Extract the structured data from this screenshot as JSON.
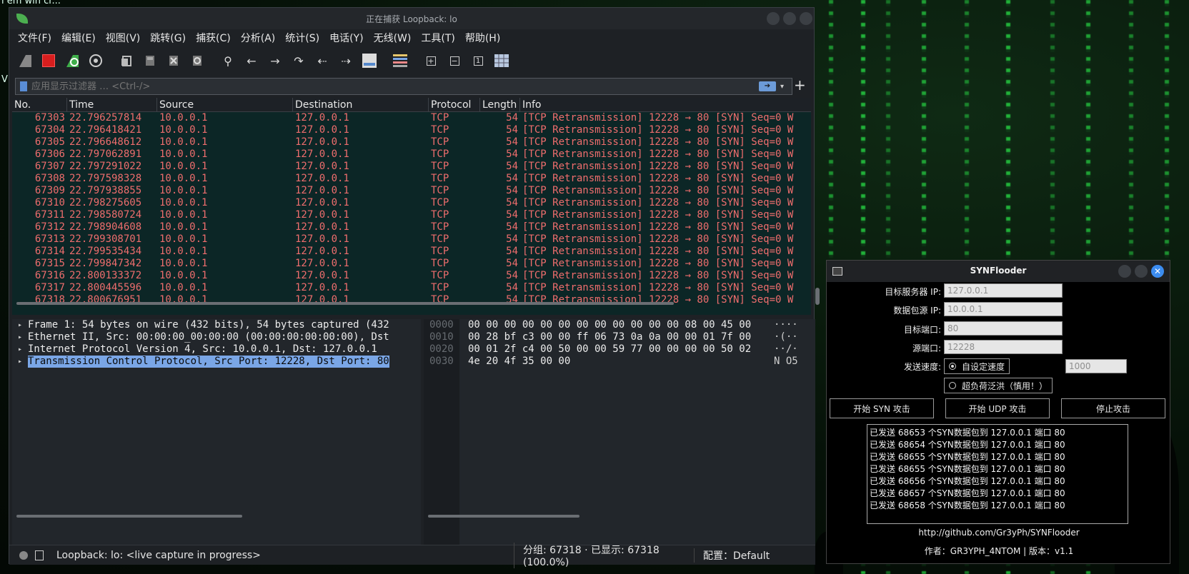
{
  "desktop": {
    "clipped_text": "ı em win cr...",
    "clipped_text_2": "V"
  },
  "wireshark": {
    "title": "正在捕获 Loopback: lo",
    "menu": [
      "文件(F)",
      "编辑(E)",
      "视图(V)",
      "跳转(G)",
      "捕获(C)",
      "分析(A)",
      "统计(S)",
      "电话(Y)",
      "无线(W)",
      "工具(T)",
      "帮助(H)"
    ],
    "filter_placeholder": "应用显示过滤器 … <Ctrl-/>",
    "columns": [
      "No.",
      "Time",
      "Source",
      "Destination",
      "Protocol",
      "Length",
      "Info"
    ],
    "packets": [
      {
        "no": "67303",
        "time": "22.796257814",
        "src": "10.0.0.1",
        "dst": "127.0.0.1",
        "proto": "TCP",
        "len": "54",
        "info": "[TCP Retransmission] 12228 → 80 [SYN] Seq=0 W"
      },
      {
        "no": "67304",
        "time": "22.796418421",
        "src": "10.0.0.1",
        "dst": "127.0.0.1",
        "proto": "TCP",
        "len": "54",
        "info": "[TCP Retransmission] 12228 → 80 [SYN] Seq=0 W"
      },
      {
        "no": "67305",
        "time": "22.796648612",
        "src": "10.0.0.1",
        "dst": "127.0.0.1",
        "proto": "TCP",
        "len": "54",
        "info": "[TCP Retransmission] 12228 → 80 [SYN] Seq=0 W"
      },
      {
        "no": "67306",
        "time": "22.797062891",
        "src": "10.0.0.1",
        "dst": "127.0.0.1",
        "proto": "TCP",
        "len": "54",
        "info": "[TCP Retransmission] 12228 → 80 [SYN] Seq=0 W"
      },
      {
        "no": "67307",
        "time": "22.797291022",
        "src": "10.0.0.1",
        "dst": "127.0.0.1",
        "proto": "TCP",
        "len": "54",
        "info": "[TCP Retransmission] 12228 → 80 [SYN] Seq=0 W"
      },
      {
        "no": "67308",
        "time": "22.797598328",
        "src": "10.0.0.1",
        "dst": "127.0.0.1",
        "proto": "TCP",
        "len": "54",
        "info": "[TCP Retransmission] 12228 → 80 [SYN] Seq=0 W"
      },
      {
        "no": "67309",
        "time": "22.797938855",
        "src": "10.0.0.1",
        "dst": "127.0.0.1",
        "proto": "TCP",
        "len": "54",
        "info": "[TCP Retransmission] 12228 → 80 [SYN] Seq=0 W"
      },
      {
        "no": "67310",
        "time": "22.798275605",
        "src": "10.0.0.1",
        "dst": "127.0.0.1",
        "proto": "TCP",
        "len": "54",
        "info": "[TCP Retransmission] 12228 → 80 [SYN] Seq=0 W"
      },
      {
        "no": "67311",
        "time": "22.798580724",
        "src": "10.0.0.1",
        "dst": "127.0.0.1",
        "proto": "TCP",
        "len": "54",
        "info": "[TCP Retransmission] 12228 → 80 [SYN] Seq=0 W"
      },
      {
        "no": "67312",
        "time": "22.798904608",
        "src": "10.0.0.1",
        "dst": "127.0.0.1",
        "proto": "TCP",
        "len": "54",
        "info": "[TCP Retransmission] 12228 → 80 [SYN] Seq=0 W"
      },
      {
        "no": "67313",
        "time": "22.799308701",
        "src": "10.0.0.1",
        "dst": "127.0.0.1",
        "proto": "TCP",
        "len": "54",
        "info": "[TCP Retransmission] 12228 → 80 [SYN] Seq=0 W"
      },
      {
        "no": "67314",
        "time": "22.799535434",
        "src": "10.0.0.1",
        "dst": "127.0.0.1",
        "proto": "TCP",
        "len": "54",
        "info": "[TCP Retransmission] 12228 → 80 [SYN] Seq=0 W"
      },
      {
        "no": "67315",
        "time": "22.799847342",
        "src": "10.0.0.1",
        "dst": "127.0.0.1",
        "proto": "TCP",
        "len": "54",
        "info": "[TCP Retransmission] 12228 → 80 [SYN] Seq=0 W"
      },
      {
        "no": "67316",
        "time": "22.800133372",
        "src": "10.0.0.1",
        "dst": "127.0.0.1",
        "proto": "TCP",
        "len": "54",
        "info": "[TCP Retransmission] 12228 → 80 [SYN] Seq=0 W"
      },
      {
        "no": "67317",
        "time": "22.800445596",
        "src": "10.0.0.1",
        "dst": "127.0.0.1",
        "proto": "TCP",
        "len": "54",
        "info": "[TCP Retransmission] 12228 → 80 [SYN] Seq=0 W"
      },
      {
        "no": "67318",
        "time": "22.800676951",
        "src": "10.0.0.1",
        "dst": "127.0.0.1",
        "proto": "TCP",
        "len": "54",
        "info": "[TCP Retransmission] 12228 → 80 [SYN] Seq=0 W"
      }
    ],
    "details": [
      "Frame 1: 54 bytes on wire (432 bits), 54 bytes captured (432",
      "Ethernet II, Src: 00:00:00_00:00:00 (00:00:00:00:00:00), Dst",
      "Internet Protocol Version 4, Src: 10.0.0.1, Dst: 127.0.0.1",
      "Transmission Control Protocol, Src Port: 12228, Dst Port: 80"
    ],
    "hex": [
      {
        "off": "0000",
        "hex": "00 00 00 00 00 00 00 00  00 00 00 00 08 00 45 00",
        "ascii": "····"
      },
      {
        "off": "0010",
        "hex": "00 28 bf c3 00 00 ff 06  73 0a 0a 00 00 01 7f 00",
        "ascii": "·(··"
      },
      {
        "off": "0020",
        "hex": "00 01 2f c4 00 50 00 00  59 77 00 00 00 00 50 02",
        "ascii": "··/·"
      },
      {
        "off": "0030",
        "hex": "4e 20 4f 35 00 00",
        "ascii": "N O5"
      }
    ],
    "status": {
      "interface": "Loopback: lo: <live capture in progress>",
      "packets": "分组: 67318 · 已显示: 67318 (100.0%)",
      "profile": "配置：Default"
    }
  },
  "synflooder": {
    "title": "SYNFlooder",
    "fields": [
      {
        "label": "目标服务器 IP:",
        "value": "127.0.0.1"
      },
      {
        "label": "数据包源 IP:",
        "value": "10.0.0.1"
      },
      {
        "label": "目标端口:",
        "value": "80"
      },
      {
        "label": "源端口:",
        "value": "12228"
      }
    ],
    "speed_label": "发送速度:",
    "speed_custom": "自设定速度",
    "speed_value": "1000",
    "speed_flood": "超负荷泛洪（慎用！）",
    "buttons": [
      "开始 SYN 攻击",
      "开始 UDP 攻击",
      "停止攻击"
    ],
    "log": [
      "已发送 68653 个SYN数据包到 127.0.0.1 端口 80",
      "已发送 68654 个SYN数据包到 127.0.0.1 端口 80",
      "已发送 68655 个SYN数据包到 127.0.0.1 端口 80",
      "已发送 68655 个SYN数据包到 127.0.0.1 端口 80",
      "已发送 68656 个SYN数据包到 127.0.0.1 端口 80",
      "已发送 68657 个SYN数据包到 127.0.0.1 端口 80",
      "已发送 68658 个SYN数据包到 127.0.0.1 端口 80"
    ],
    "link": "http://github.com/Gr3yPh/SYNFlooder",
    "author": "作者：GR3YPH_4NTOM | 版本：v1.1"
  }
}
